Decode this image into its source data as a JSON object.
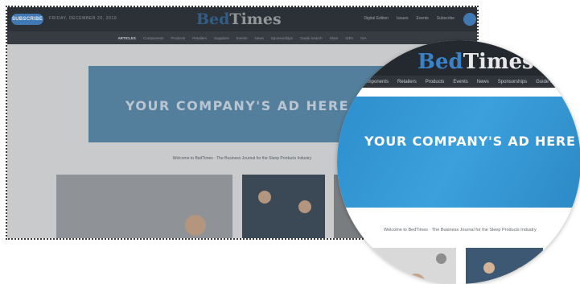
{
  "header": {
    "subscribe_label": "SUBSCRIBE",
    "date_text": "FRIDAY, DECEMBER 20, 2019",
    "logo_part1": "Bed",
    "logo_part2": "Times",
    "top_links": [
      "Digital Edition",
      "Issues",
      "Events",
      "Subscribe"
    ]
  },
  "menu": {
    "items": [
      "ARTICLES",
      "Components",
      "Products",
      "Retailers",
      "Suppliers",
      "Events",
      "News",
      "Sponsorships",
      "Guide Search",
      "Store",
      "ISPA",
      "ISA"
    ]
  },
  "ad": {
    "text": "YOUR COMPANY'S AD HERE"
  },
  "welcome": {
    "text": "Welcome to BedTimes · The Business Journal for the Sleep Products Industry"
  },
  "magnifier": {
    "logo_part1": "Bed",
    "logo_part2": "Times",
    "menu_items": [
      "Components",
      "Retailers",
      "Products",
      "Events",
      "News",
      "Sponsorships",
      "Guide Search"
    ],
    "ad_text": "YOUR COMPANY'S AD HERE",
    "welcome_text": "Welcome to BedTimes · The Business Journal for the Sleep Products Industry"
  },
  "colors": {
    "accent": "#3a82c8",
    "ad_background": "#2d8fcd",
    "topbar": "#23292e"
  }
}
